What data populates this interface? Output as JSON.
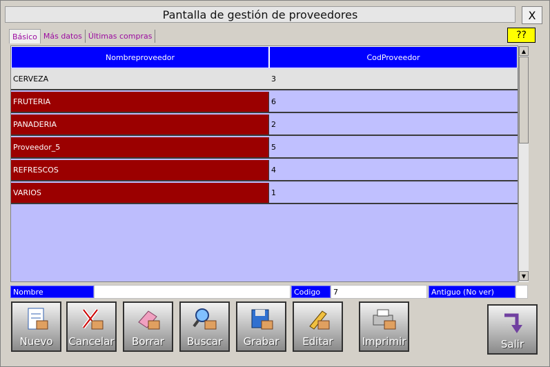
{
  "window": {
    "title": "Pantalla de gestión de proveedores",
    "close_label": "X"
  },
  "tabs": [
    {
      "label": "Básico",
      "active": true
    },
    {
      "label": "Más datos",
      "active": false
    },
    {
      "label": "Últimas compras",
      "active": false
    }
  ],
  "help_label": "??",
  "grid": {
    "columns": [
      "Nombreproveedor",
      "CodProveedor"
    ],
    "rows": [
      {
        "name": "CERVEZA",
        "code": "3"
      },
      {
        "name": "FRUTERIA",
        "code": "6"
      },
      {
        "name": "PANADERIA",
        "code": "2"
      },
      {
        "name": "Proveedor_5",
        "code": "5"
      },
      {
        "name": "REFRESCOS",
        "code": "4"
      },
      {
        "name": "VARIOS",
        "code": "1"
      }
    ]
  },
  "fields": {
    "nombre_label": "Nombre",
    "nombre_value": "",
    "codigo_label": "Codigo",
    "codigo_value": "7",
    "antiguo_label": "Antiguo (No ver)"
  },
  "buttons": {
    "nuevo": "Nuevo",
    "cancelar": "Cancelar",
    "borrar": "Borrar",
    "buscar": "Buscar",
    "grabar": "Grabar",
    "editar": "Editar",
    "imprimir": "Imprimir",
    "salir": "Salir"
  },
  "colors": {
    "header": "#0000ff",
    "name_cell": "#9b0000",
    "code_cell": "#c0c0ff",
    "grid_bg": "#bdbdfd",
    "help_bg": "#ffff00"
  }
}
